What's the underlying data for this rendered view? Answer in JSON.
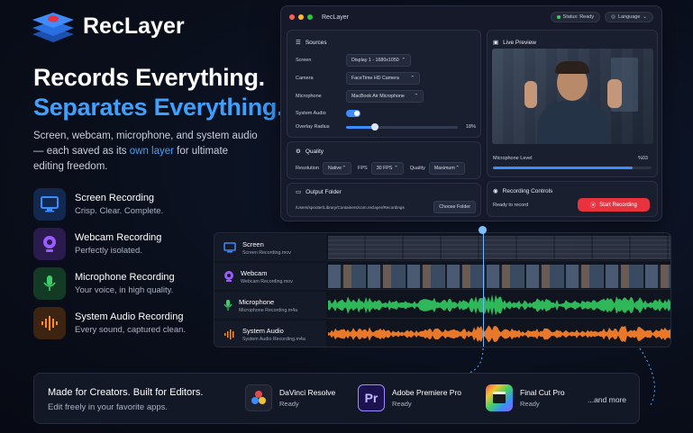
{
  "brand": {
    "name": "RecLayer"
  },
  "hero": {
    "line1": "Records Everything.",
    "line2": "Separates Everything.",
    "desc_pre": "Screen, webcam, microphone, and system audio — each saved as its ",
    "desc_highlight": "own layer",
    "desc_post": " for ultimate editing freedom."
  },
  "features": [
    {
      "title": "Screen Recording",
      "subtitle": "Crisp. Clear. Complete.",
      "icon": "monitor-icon",
      "color": "#3a8cff"
    },
    {
      "title": "Webcam Recording",
      "subtitle": "Perfectly isolated.",
      "icon": "webcam-icon",
      "color": "#9b5cff"
    },
    {
      "title": "Microphone Recording",
      "subtitle": "Your voice, in high quality.",
      "icon": "microphone-icon",
      "color": "#3ecf6a"
    },
    {
      "title": "System Audio Recording",
      "subtitle": "Every sound, captured clean.",
      "icon": "audio-wave-icon",
      "color": "#ff8a2a"
    }
  ],
  "window": {
    "title": "RecLayer",
    "status": "Status: Ready",
    "language": "Language",
    "sources": {
      "header": "Sources",
      "screen_label": "Screen",
      "screen_value": "Display 1 - 1680x1050",
      "camera_label": "Camera",
      "camera_value": "FaceTime HD Camera",
      "mic_label": "Microphone",
      "mic_value": "MacBook Air Microphone",
      "sysaudio_label": "System Audio",
      "sysaudio_on": true,
      "overlay_label": "Overlay Radius",
      "overlay_value": "18%",
      "overlay_fraction": 0.18
    },
    "quality": {
      "header": "Quality",
      "resolution_label": "Resolution",
      "resolution_value": "Native",
      "fps_label": "FPS",
      "fps_value": "30 FPS",
      "quality_label": "Quality",
      "quality_value": "Maximum"
    },
    "output": {
      "header": "Output Folder",
      "path": "/Users/spooter/Library/Containers/com.reclayer/Recordings",
      "choose": "Choose Folder"
    },
    "preview": {
      "header": "Live Preview",
      "mic_level_label": "Microphone Level",
      "mic_level_value": "%03",
      "mic_level_fraction": 0.88
    },
    "controls": {
      "header": "Recording Controls",
      "status": "Ready to record",
      "start": "Start Recording"
    }
  },
  "timeline": {
    "tracks": [
      {
        "name": "Screen",
        "file": "Screen Recording.mov",
        "icon": "monitor-icon",
        "color": "#3a8cff"
      },
      {
        "name": "Webcam",
        "file": "Webcam Recording.mov",
        "icon": "webcam-icon",
        "color": "#9b5cff"
      },
      {
        "name": "Microphone",
        "file": "Microphone Recording.m4a",
        "icon": "microphone-icon",
        "color": "#3ecf6a"
      },
      {
        "name": "System Audio",
        "file": "System Audio Recording.m4a",
        "icon": "audio-wave-icon",
        "color": "#ff8a2a"
      }
    ]
  },
  "bottom": {
    "title": "Made for Creators. Built for Editors.",
    "subtitle": "Edit freely in your favorite apps.",
    "apps": [
      {
        "name": "DaVinci Resolve",
        "status": "Ready",
        "icon": "davinci-resolve-icon"
      },
      {
        "name": "Adobe Premiere Pro",
        "status": "Ready",
        "icon": "premiere-pro-icon",
        "glyph": "Pr"
      },
      {
        "name": "Final Cut Pro",
        "status": "Ready",
        "icon": "final-cut-pro-icon"
      }
    ],
    "more": "...and more"
  }
}
